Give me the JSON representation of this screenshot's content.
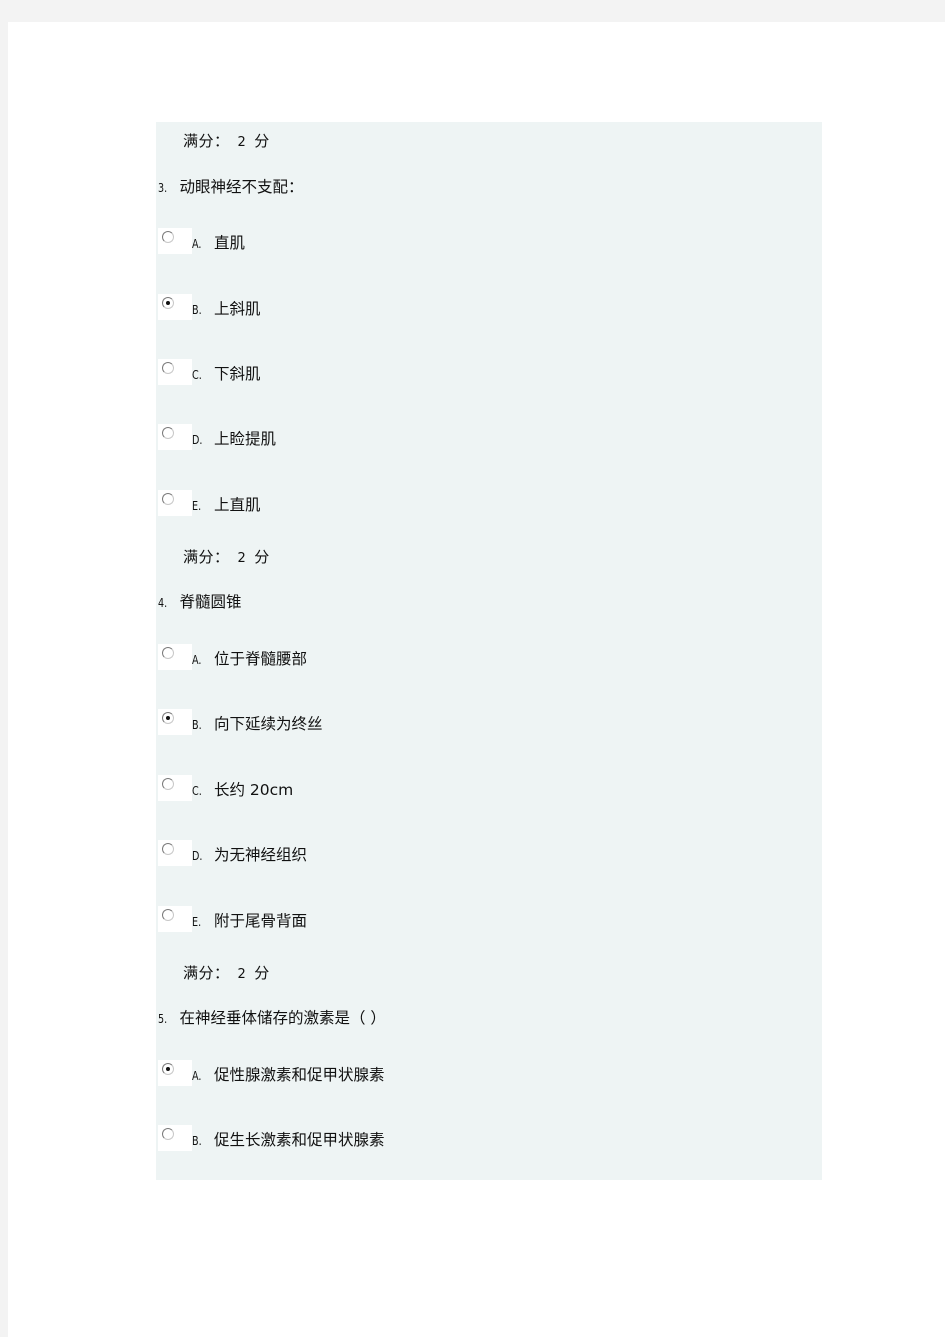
{
  "score_label": "满分：",
  "score_value": "2",
  "score_unit": "分",
  "questions": [
    {
      "number": "3.",
      "text": "动眼神经不支配：",
      "options": [
        {
          "letter": "A.",
          "text": "直肌",
          "checked": false
        },
        {
          "letter": "B.",
          "text": "上斜肌",
          "checked": true
        },
        {
          "letter": "C.",
          "text": "下斜肌",
          "checked": false
        },
        {
          "letter": "D.",
          "text": "上睑提肌",
          "checked": false
        },
        {
          "letter": "E.",
          "text": "上直肌",
          "checked": false
        }
      ]
    },
    {
      "number": "4.",
      "text": "脊髓圆锥",
      "options": [
        {
          "letter": "A.",
          "text": "位于脊髓腰部",
          "checked": false
        },
        {
          "letter": "B.",
          "text": "向下延续为终丝",
          "checked": true
        },
        {
          "letter": "C.",
          "text": "长约 20cm",
          "checked": false
        },
        {
          "letter": "D.",
          "text": "为无神经组织",
          "checked": false
        },
        {
          "letter": "E.",
          "text": "附于尾骨背面",
          "checked": false
        }
      ]
    },
    {
      "number": "5.",
      "text": "在神经垂体储存的激素是（ ）",
      "options": [
        {
          "letter": "A.",
          "text": "促性腺激素和促甲状腺素",
          "checked": true
        },
        {
          "letter": "B.",
          "text": "促生长激素和促甲状腺素",
          "checked": false
        }
      ]
    }
  ]
}
